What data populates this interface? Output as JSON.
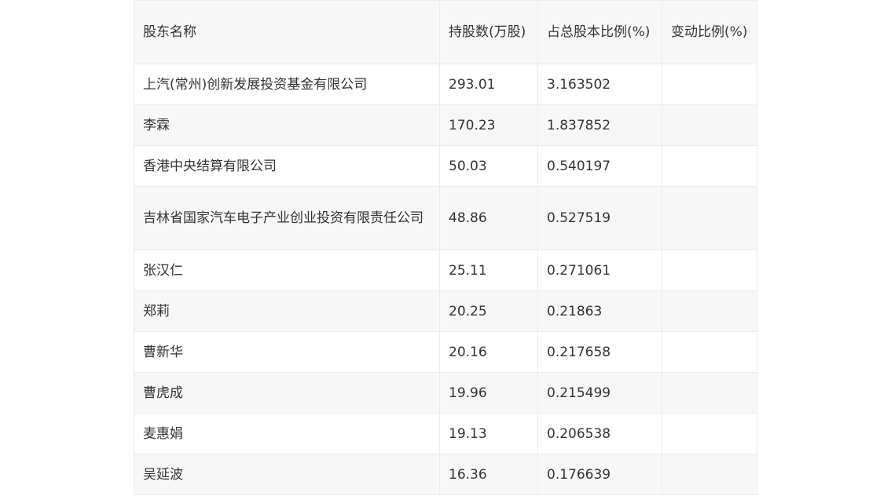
{
  "table": {
    "headers": [
      "股东名称",
      "持股数(万股)",
      "占总股本比例(%)",
      "变动比例(%)"
    ],
    "rows": [
      [
        "上汽(常州)创新发展投资基金有限公司",
        "293.01",
        "3.163502",
        ""
      ],
      [
        "李霖",
        "170.23",
        "1.837852",
        ""
      ],
      [
        "香港中央结算有限公司",
        "50.03",
        "0.540197",
        ""
      ],
      [
        "吉林省国家汽车电子产业创业投资有限责任公司",
        "48.86",
        "0.527519",
        ""
      ],
      [
        "张汉仁",
        "25.11",
        "0.271061",
        ""
      ],
      [
        "郑莉",
        "20.25",
        "0.21863",
        ""
      ],
      [
        "曹新华",
        "20.16",
        "0.217658",
        ""
      ],
      [
        "曹虎成",
        "19.96",
        "0.215499",
        ""
      ],
      [
        "麦惠娟",
        "19.13",
        "0.206538",
        ""
      ],
      [
        "吴延波",
        "16.36",
        "0.176639",
        ""
      ]
    ]
  }
}
